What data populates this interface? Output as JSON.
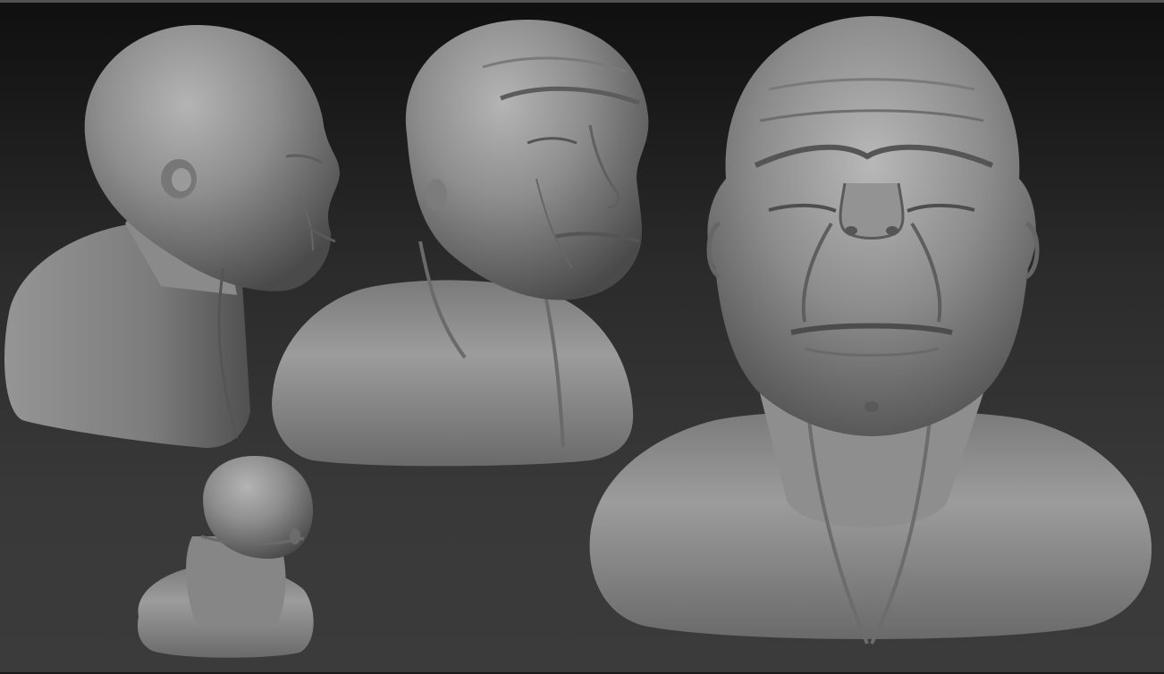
{
  "viewport": {
    "background_top": "#0f0f0f",
    "background_bottom": "#3b3b3b",
    "material_color": "#8a8a8a"
  },
  "models": [
    {
      "name": "bust-side-view"
    },
    {
      "name": "bust-three-quarter-view"
    },
    {
      "name": "bust-front-view"
    },
    {
      "name": "bust-rear-view"
    }
  ]
}
